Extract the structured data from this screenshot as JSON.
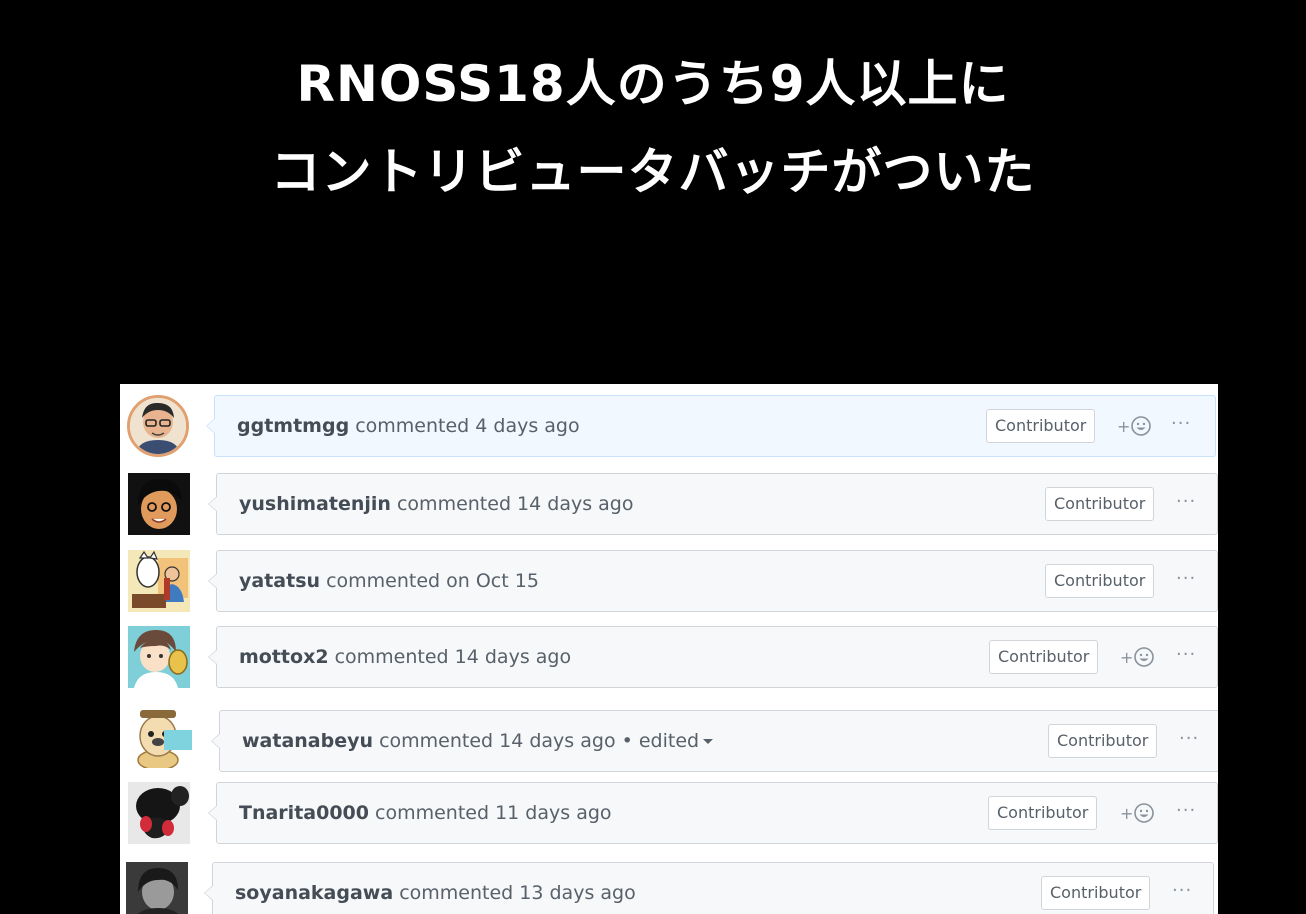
{
  "slide": {
    "title_line1": "RNOSS18人のうち9人以上に",
    "title_line2": "コントリビュータバッチがついた"
  },
  "comments": [
    {
      "author": "ggtmtmgg",
      "action": "commented 4 days ago",
      "badge": "Contributor",
      "more": "···"
    },
    {
      "author": "yushimatenjin",
      "action": "commented 14 days ago",
      "badge": "Contributor",
      "more": "···"
    },
    {
      "author": "yatatsu",
      "action": "commented on Oct 15",
      "badge": "Contributor",
      "more": "···"
    },
    {
      "author": "mottox2",
      "action": "commented 14 days ago",
      "badge": "Contributor",
      "more": "···"
    },
    {
      "author": "watanabeyu",
      "action": "commented 14 days ago • edited",
      "badge": "Contributor",
      "more": "···"
    },
    {
      "author": "Tnarita0000",
      "action": "commented 11 days ago",
      "badge": "Contributor",
      "more": "···"
    },
    {
      "author": "soyanakagawa",
      "action": "commented 13 days ago",
      "badge": "Contributor",
      "more": "···"
    }
  ],
  "reaction_plus": "+",
  "icons": {
    "reaction": "smiley-icon",
    "more": "kebab-horizontal-icon",
    "edited": "triangle-down-icon"
  },
  "colors": {
    "slide_background": "#000000",
    "title_text": "#ffffff",
    "header_background": "#f6f8fa",
    "highlight_header_background": "#f1f8ff",
    "border": "#d1d5da"
  }
}
